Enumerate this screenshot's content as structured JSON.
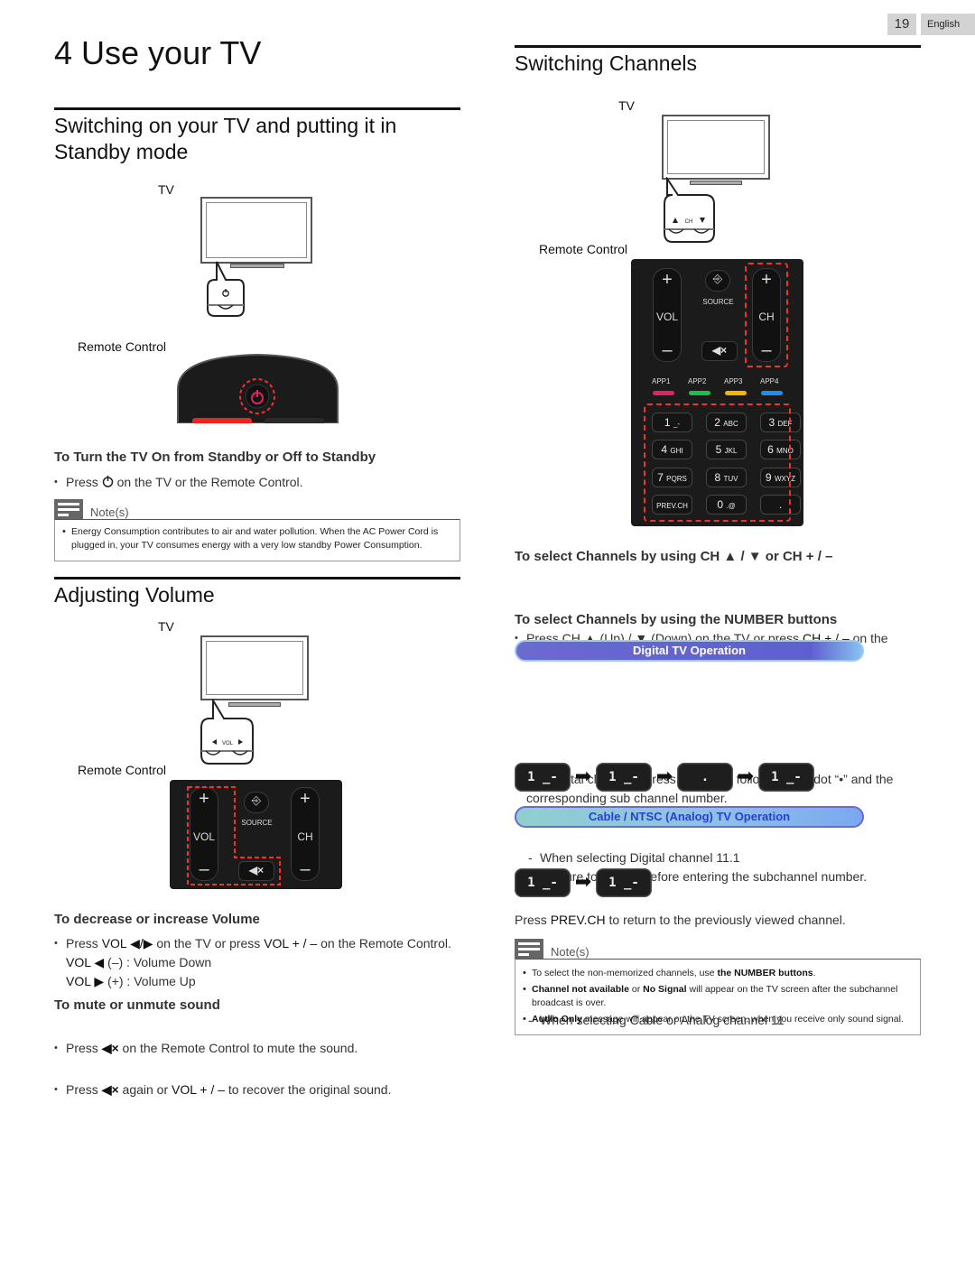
{
  "header": {
    "page_number": "19",
    "language": "English"
  },
  "chapter_title": "4  Use your TV",
  "standby": {
    "heading": "Switching on your TV and putting it in Standby mode",
    "tv_label": "TV",
    "remote_label": "Remote Control",
    "subheading": "To Turn the TV On from Standby or Off to Standby",
    "bullet_pre": "Press",
    "bullet_post": "on the TV or the Remote Control.",
    "note_title": "Note(s)",
    "notes": [
      "Energy Consumption contributes to air and water pollution. When the AC Power Cord is plugged in, your TV consumes energy with a very low standby Power Consumption."
    ]
  },
  "volume": {
    "heading": "Adjusting Volume",
    "tv_label": "TV",
    "tv_button_label": "VOL",
    "remote_label": "Remote Control",
    "sub1": "To decrease or increase Volume",
    "b1_pre": "Press",
    "b1_vol": "VOL ◀/▶",
    "b1_mid": "on the TV or press",
    "b1_vol2": "VOL + / –",
    "b1_post": "on the Remote Control.",
    "down_key": "VOL ◀",
    "down_text": "(–) : Volume Down",
    "up_key": "VOL ▶",
    "up_text": "(+) : Volume Up",
    "sub2": "To mute or unmute sound",
    "b2_pre": "Press",
    "b2_post": "on the Remote Control to mute the sound.",
    "b3_pre": "Press",
    "b3_mid": "again or",
    "b3_vol": "VOL + / –",
    "b3_post": "to recover the original sound."
  },
  "remote_buttons": {
    "plus": "+",
    "minus": "–",
    "vol": "VOL",
    "ch": "CH",
    "source": "SOURCE"
  },
  "channels": {
    "heading": "Switching Channels",
    "tv_label": "TV",
    "tv_button_label": "CH",
    "remote_label": "Remote Control",
    "apps": [
      {
        "label": "APP1",
        "color": "#e0245e"
      },
      {
        "label": "APP2",
        "color": "#1fbf4a"
      },
      {
        "label": "APP3",
        "color": "#f5b400"
      },
      {
        "label": "APP4",
        "color": "#1e8ff0"
      }
    ],
    "numpad": [
      {
        "main": "1",
        "sub": "_-"
      },
      {
        "main": "2",
        "sub": "ABC"
      },
      {
        "main": "3",
        "sub": "DEF"
      },
      {
        "main": "4",
        "sub": "GHI"
      },
      {
        "main": "5",
        "sub": "JKL"
      },
      {
        "main": "6",
        "sub": "MNO"
      },
      {
        "main": "7",
        "sub": "PQRS"
      },
      {
        "main": "8",
        "sub": "TUV"
      },
      {
        "main": "9",
        "sub": "WXYZ"
      },
      {
        "main": "PREV.CH",
        "sub": ""
      },
      {
        "main": "0",
        "sub": ".@"
      },
      {
        "main": ".",
        "sub": ""
      }
    ],
    "sub1": "To select Channels by using CH ▲ / ▼ or CH + / –",
    "b1_pre": "Press CH ▲ (Up) / ▼ (Down) on the TV or press",
    "b1_ch": "CH + / –",
    "b1_post": "on the Remote Control.",
    "sub2": "To select Channels by using the NUMBER buttons",
    "digital_pill": "Digital TV Operation",
    "digital_b1": "For Digital channels, press a number followed by a dot “•” and the corresponding sub channel number.",
    "digital_dash": "When selecting Digital channel 11.1",
    "digital_dash2": "Be sure to press • before entering the subchannel number.",
    "digital_keys": [
      "1 _-",
      "1 _-",
      ".",
      "1 _-"
    ],
    "cable_pill": "Cable / NTSC (Analog) TV Operation",
    "cable_dash": "When selecting Cable or Analog channel 11",
    "cable_keys": [
      "1 _-",
      "1 _-"
    ],
    "prev_pre": "Press",
    "prev_key": "PREV.CH",
    "prev_post": "to return to the previously viewed channel.",
    "note_title": "Note(s)",
    "note1_pre": "To select the non-memorized channels, use",
    "note1_b": "the NUMBER buttons",
    "note2_b1": "Channel not available",
    "note2_mid": "or",
    "note2_b2": "No Signal",
    "note2_post": "will appear on the TV screen after the subchannel broadcast is over.",
    "note3_b": "Audio Only",
    "note3_post": "message will appear on the TV screen, when you receive only sound signal."
  }
}
